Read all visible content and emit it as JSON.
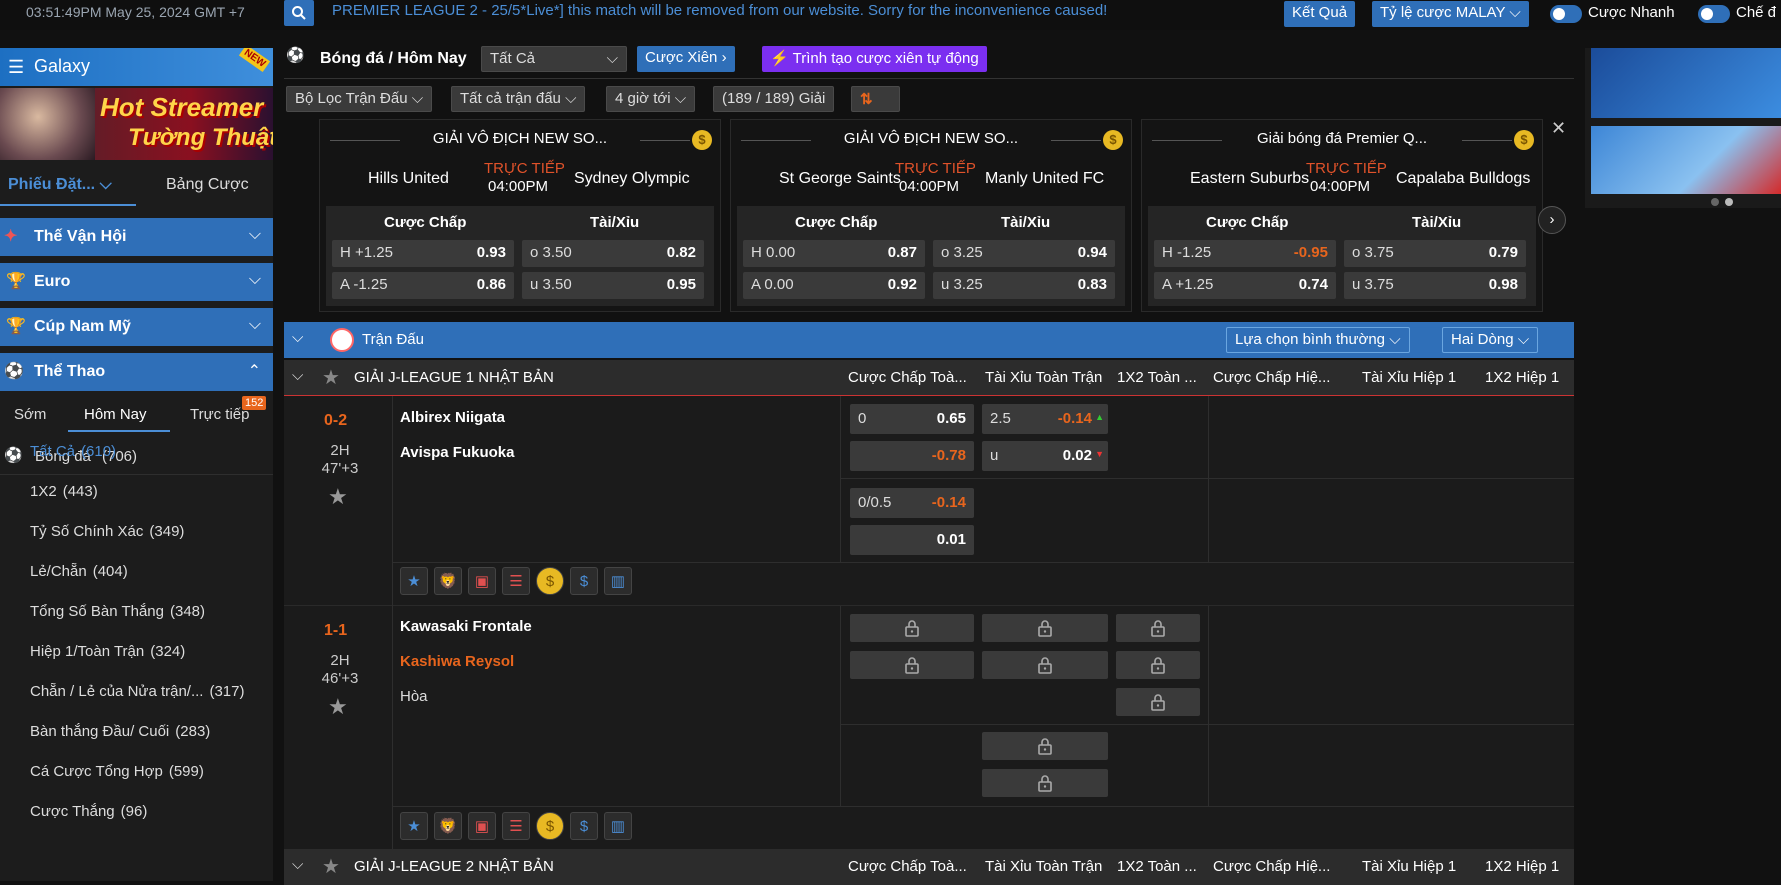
{
  "topbar": {
    "clock": "03:51:49PM May 25, 2024 GMT +7",
    "ticker": "PREMIER LEAGUE 2 - 25/5*Live*] this match will be removed from our website. Sorry for the inconvenience caused!",
    "results_label": "Kết Quả",
    "odds_type_label": "Tỷ lệ cược MALAY",
    "quick_bet_label": "Cược Nhanh",
    "mode_label": "Chế đ"
  },
  "sidebar": {
    "galaxy_label": "Galaxy",
    "new_badge": "NEW",
    "streamer_title": "Hot Streamer",
    "streamer_sub": "Tường Thuật",
    "tab_bet_slip": "Phiếu Đặt...",
    "tab_bet_table": "Bảng Cược",
    "sections": [
      "Thế Vận Hội",
      "Euro",
      "Cúp Nam Mỹ",
      "Thể Thao"
    ],
    "time_tabs": [
      "Sớm",
      "Hôm Nay",
      "Trực tiếp"
    ],
    "live_count": "152",
    "sport_label": "Bóng đá",
    "sport_count": "(706)",
    "items": [
      {
        "label": "Tất Cả",
        "count": "(610)"
      },
      {
        "label": "1X2",
        "count": "(443)"
      },
      {
        "label": "Tỷ Số Chính Xác",
        "count": "(349)"
      },
      {
        "label": "Lẻ/Chẵn",
        "count": "(404)"
      },
      {
        "label": "Tổng Số Bàn Thắng",
        "count": "(348)"
      },
      {
        "label": "Hiệp 1/Toàn Trận",
        "count": "(324)"
      },
      {
        "label": "Chẵn / Lẻ của Nửa trận/...",
        "count": "(317)"
      },
      {
        "label": "Bàn thắng Đầu/ Cuối",
        "count": "(283)"
      },
      {
        "label": "Cá Cược Tổng Hợp",
        "count": "(599)"
      },
      {
        "label": "Cược Thắng",
        "count": "(96)"
      }
    ]
  },
  "header": {
    "title": "Bóng đá / Hôm Nay",
    "filter_all": "Tất Cả",
    "parlay": "Cược Xiên",
    "auto_parlay": "Trình tạo cược xiên tự động",
    "match_filter": "Bộ Lọc Trận Đấu",
    "all_matches": "Tất cả trận đấu",
    "time_window": "4 giờ tới",
    "league_count": "(189 / 189) Giải"
  },
  "featured": [
    {
      "league": "GIẢI VÔ ĐỊCH NEW SO...",
      "home": "Hills United",
      "away": "Sydney Olympic",
      "status": "TRỰC TIẾP",
      "time": "04:00PM",
      "hdp_label": "Cược Chấp",
      "ou_label": "Tài/Xỉu",
      "rows": [
        {
          "hdp_l": "H +1.25",
          "hdp_r": "0.93",
          "ou_l": "o 3.50",
          "ou_r": "0.82"
        },
        {
          "hdp_l": "A -1.25",
          "hdp_r": "0.86",
          "ou_l": "u 3.50",
          "ou_r": "0.95"
        }
      ]
    },
    {
      "league": "GIẢI VÔ ĐỊCH NEW SO...",
      "home": "St George Saints",
      "away": "Manly United FC",
      "status": "TRỰC TIẾP",
      "time": "04:00PM",
      "hdp_label": "Cược Chấp",
      "ou_label": "Tài/Xỉu",
      "rows": [
        {
          "hdp_l": "H 0.00",
          "hdp_r": "0.87",
          "ou_l": "o 3.25",
          "ou_r": "0.94"
        },
        {
          "hdp_l": "A 0.00",
          "hdp_r": "0.92",
          "ou_l": "u 3.25",
          "ou_r": "0.83"
        }
      ]
    },
    {
      "league": "Giải bóng đá Premier Q...",
      "home": "Eastern Suburbs",
      "away": "Capalaba Bulldogs",
      "status": "TRỰC TIẾP",
      "time": "04:00PM",
      "hdp_label": "Cược Chấp",
      "ou_label": "Tài/Xỉu",
      "rows": [
        {
          "hdp_l": "H -1.25",
          "hdp_r": "-0.95",
          "ou_l": "o 3.75",
          "ou_r": "0.79"
        },
        {
          "hdp_l": "A +1.25",
          "hdp_r": "0.74",
          "ou_l": "u 3.75",
          "ou_r": "0.98"
        }
      ]
    }
  ],
  "table": {
    "header_label": "Trận Đấu",
    "sort_label": "Lựa chọn bình thường",
    "lines_label": "Hai Dòng",
    "columns": [
      "Cược Chấp Toà...",
      "Tài Xỉu Toàn Trận",
      "1X2 Toàn ...",
      "Cược Chấp Hiệ...",
      "Tài Xỉu Hiệp 1",
      "1X2 Hiệp 1"
    ],
    "leagues": [
      "GIẢI J-LEAGUE 1 NHẬT BẢN",
      "GIẢI J-LEAGUE 2 NHẬT BẢN"
    ],
    "matches": [
      {
        "score": "0-2",
        "period": "2H",
        "minute": "47'+3",
        "home": "Albirex Niigata",
        "away": "Avispa Fukuoka",
        "hdp1_l": "0",
        "hdp1_r": "0.65",
        "hdp2_r": "-0.78",
        "ou1_l": "2.5",
        "ou1_r": "-0.14",
        "ou2_l": "u",
        "ou2_r": "0.02",
        "alt_hdp1_l": "0/0.5",
        "alt_hdp1_r": "-0.14",
        "alt_hdp2_r": "0.01"
      },
      {
        "score": "1-1",
        "period": "2H",
        "minute": "46'+3",
        "home": "Kawasaki Frontale",
        "away": "Kashiwa Reysol",
        "draw": "Hòa"
      }
    ]
  },
  "colors": {
    "accent": "#2f6fb8",
    "live": "#e0522a",
    "negative": "#e8651d",
    "purple": "#7b2ff0"
  }
}
